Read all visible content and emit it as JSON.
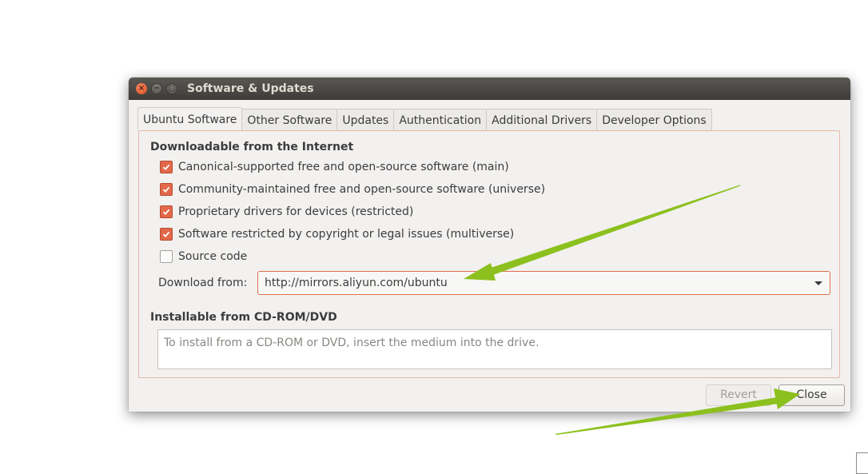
{
  "window": {
    "title": "Software & Updates",
    "close_glyph": "×",
    "minimize_glyph": "−",
    "maximize_glyph": "□"
  },
  "tabs": [
    {
      "label": "Ubuntu Software",
      "active": true
    },
    {
      "label": "Other Software",
      "active": false
    },
    {
      "label": "Updates",
      "active": false
    },
    {
      "label": "Authentication",
      "active": false
    },
    {
      "label": "Additional Drivers",
      "active": false
    },
    {
      "label": "Developer Options",
      "active": false
    }
  ],
  "internet": {
    "heading": "Downloadable from the Internet",
    "options": [
      {
        "label": "Canonical-supported free and open-source software (main)",
        "checked": true
      },
      {
        "label": "Community-maintained free and open-source software (universe)",
        "checked": true
      },
      {
        "label": "Proprietary drivers for devices (restricted)",
        "checked": true
      },
      {
        "label": "Software restricted by copyright or legal issues (multiverse)",
        "checked": true
      },
      {
        "label": "Source code",
        "checked": false
      }
    ],
    "download_from_label": "Download from:",
    "download_from_value": "http://mirrors.aliyun.com/ubuntu"
  },
  "cdrom": {
    "heading": "Installable from CD-ROM/DVD",
    "placeholder": "To install from a CD-ROM or DVD, insert the medium into the drive."
  },
  "buttons": {
    "revert_label": "Revert",
    "close_label": "Close"
  },
  "colors": {
    "accent": "#e2684a",
    "annotation_arrow": "#8cc01e",
    "titlebar": "#3d3c38"
  },
  "icons": {
    "checkbox_check": "check-icon",
    "combo_arrow": "chevron-down-icon"
  }
}
